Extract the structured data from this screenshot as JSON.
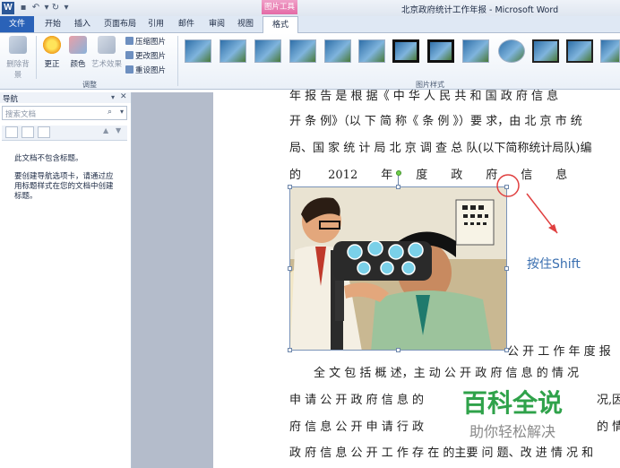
{
  "titlebar": {
    "title": "北京政府统计工作年报 - Microsoft Word",
    "context_tab_header": "图片工具",
    "app_icon": "W"
  },
  "tabs": {
    "file": "文件",
    "items": [
      "开始",
      "插入",
      "页面布局",
      "引用",
      "邮件",
      "审阅",
      "视图"
    ],
    "format": "格式"
  },
  "ribbon": {
    "remove_background": "删除背景",
    "corrections": "更正",
    "color": "颜色",
    "artistic_effects": "艺术效果",
    "compress_pictures": "压缩图片",
    "change_picture": "更改图片",
    "reset_picture": "重设图片",
    "adjust_group_label": "调整",
    "styles_group_label": "图片样式"
  },
  "nav": {
    "title": "导航",
    "search_placeholder": "搜索文档",
    "no_headings": "此文档不包含标题。",
    "hint": "要创建导航选项卡，请通过应用标题样式在您的文档中创建标题。"
  },
  "document": {
    "lines": [
      "年 报 告 是 根 据《 中 华 人 民 共 和 国 政 府 信 息",
      "开 条 例》（以 下 简 称《 条 例 》）要 求，由 北 京 市 统",
      "局、国 家 统 计 局 北 京 调 查 总 队(以下简称统计局队)编",
      "的　　 2012　　年　　度　　政　　府　　信　　息",
      "公 开 工 作 年 度 报",
      "全 文 包 括 概 述，主 动 公 开 政 府 信 息 的 情 况",
      "申 请 公 开 政 府 信 息 的",
      "况,因",
      "府 信 息 公 开 申 请 行 政",
      "的 情",
      "政 府 信 息 公 开 工 作 存 在 的主要 问 题、改 进 情 况 和"
    ],
    "annotation": "按住Shift"
  },
  "watermark": {
    "main": "百科全说",
    "sub": "助你轻松解决"
  },
  "colors": {
    "file_tab": "#2a62b8",
    "context_tab": "#e46aa6",
    "annotation": "#3a6fb0",
    "arrow": "#e04040",
    "watermark_green": "#2fa24a"
  }
}
